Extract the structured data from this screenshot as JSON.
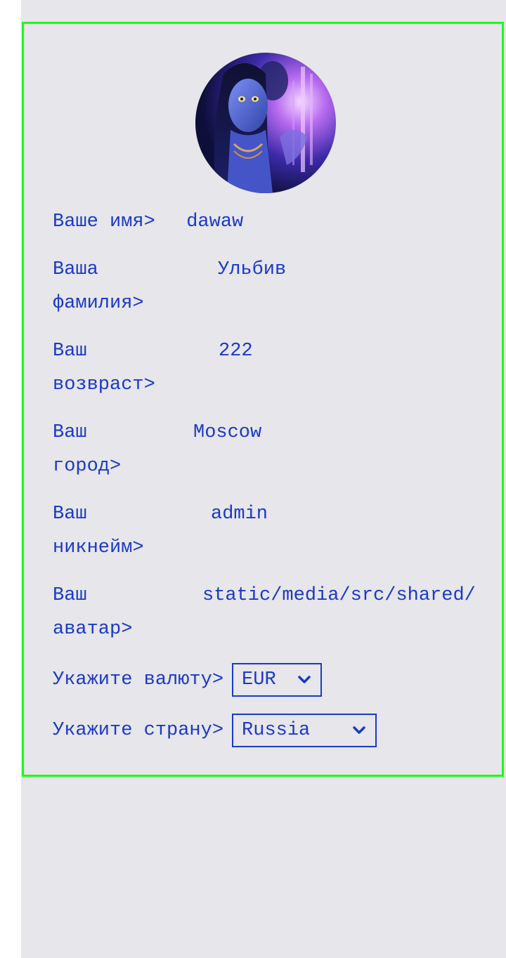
{
  "profile": {
    "avatar_alt": "avatar",
    "fields": [
      {
        "label": "Ваше имя>",
        "value": "dawaw"
      },
      {
        "label_line1": "Ваша",
        "label_line2": "фамилия>",
        "value": "Ульбив"
      },
      {
        "label_line1": "Ваш",
        "label_line2": "возвраст>",
        "value": "222"
      },
      {
        "label_line1": "Ваш",
        "label_line2": "город>",
        "value": "Moscow"
      },
      {
        "label_line1": "Ваш",
        "label_line2": "никнейм>",
        "value": "admin"
      },
      {
        "label_line1": "Ваш",
        "label_line2": "аватар>",
        "value": "static/media/src/shared/avatar.jpg"
      }
    ],
    "currency": {
      "label": "Укажите валюту>",
      "selected": "EUR"
    },
    "country": {
      "label": "Укажите страну>",
      "selected": "Russia"
    }
  },
  "colors": {
    "text": "#1b3ac4",
    "border": "#16ff16",
    "background": "#e7e6ea"
  },
  "icons": {
    "select_arrow": "chevron-down-icon"
  }
}
